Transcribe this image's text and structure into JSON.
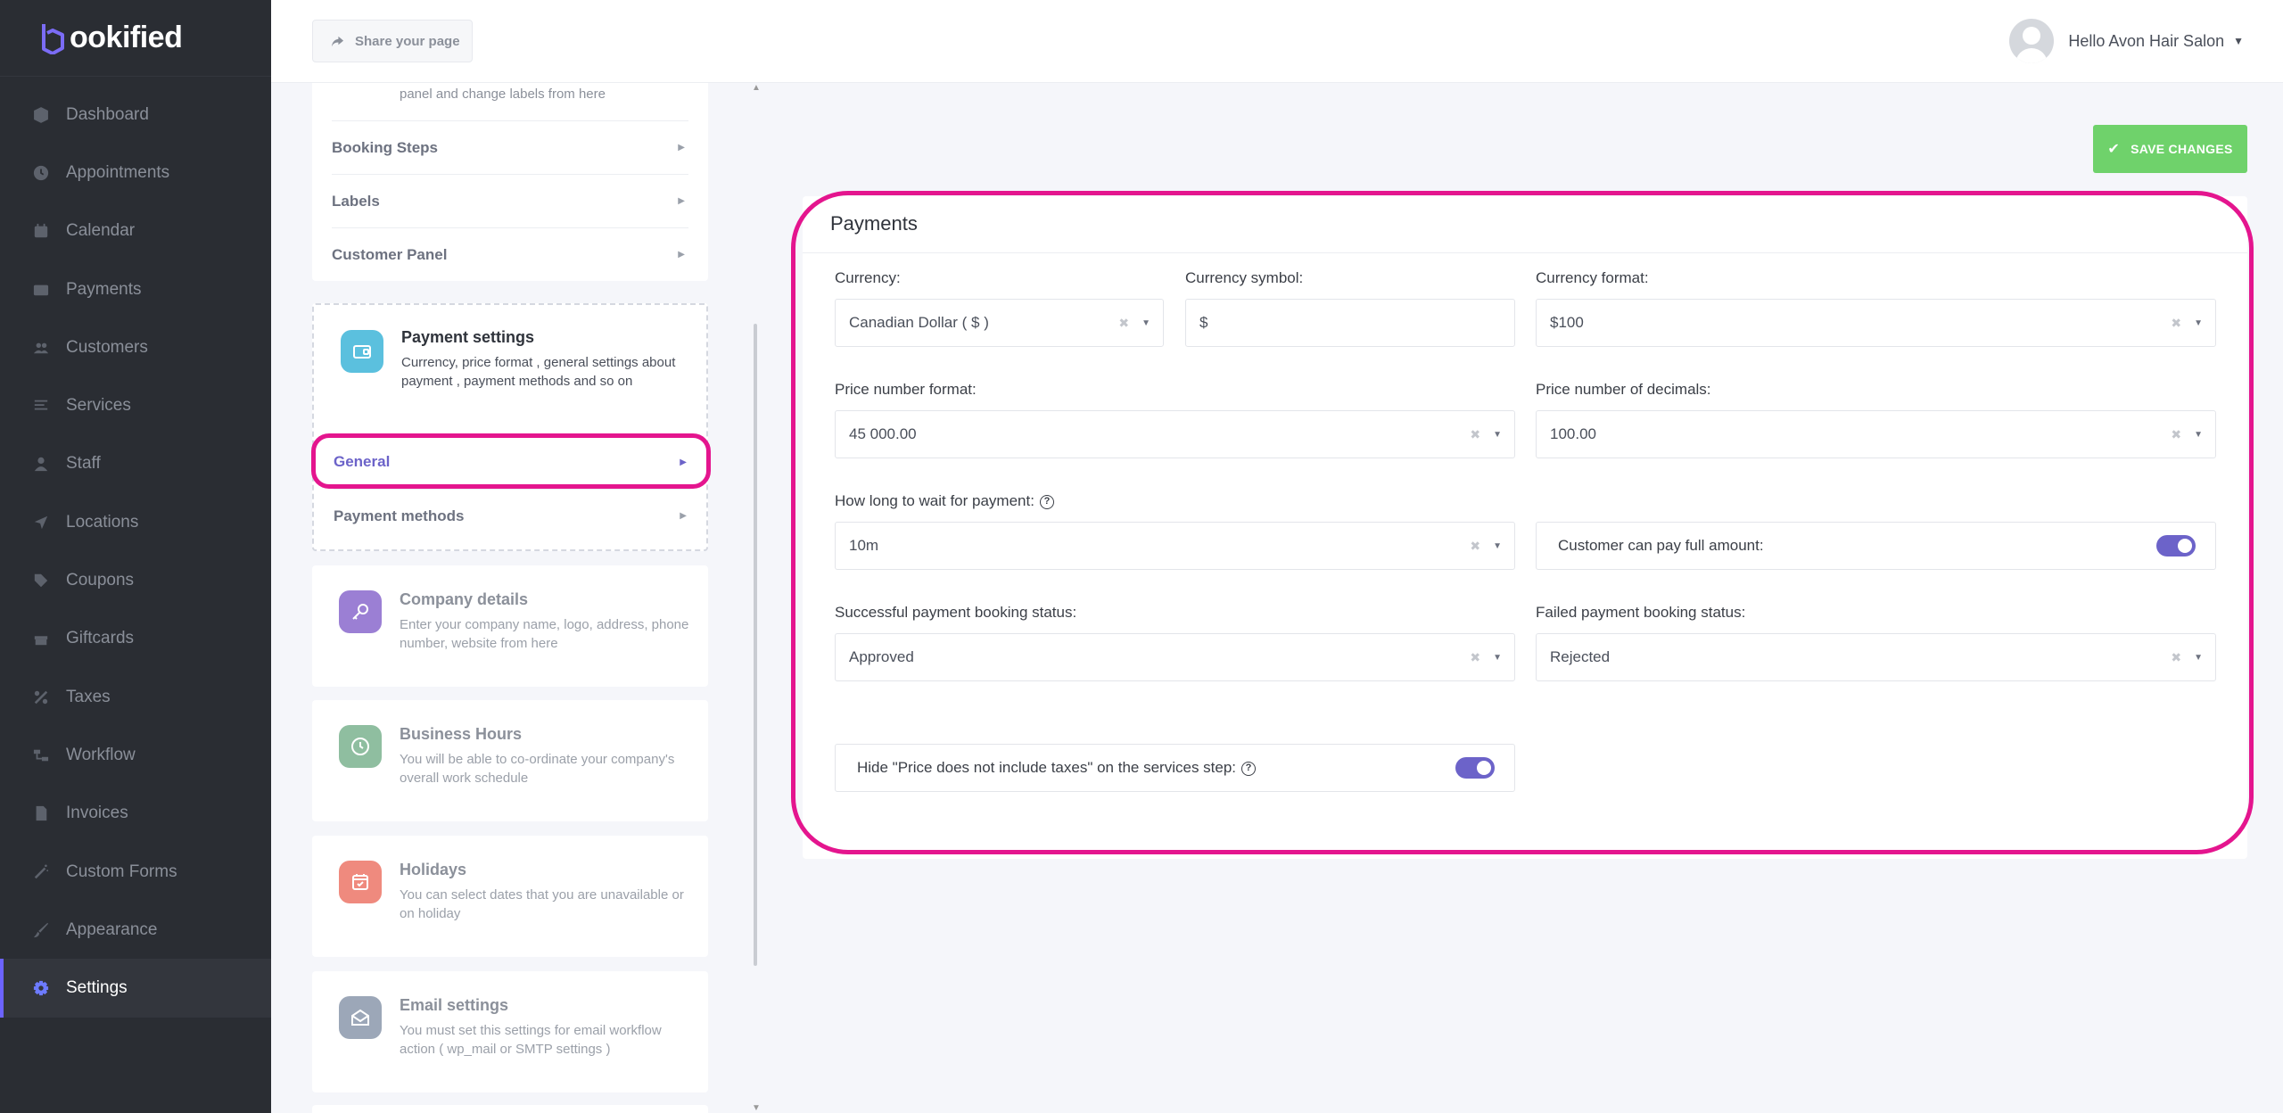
{
  "brand": {
    "logo_text": "ookified"
  },
  "sidebar": {
    "items": [
      {
        "label": "Dashboard",
        "icon": "cube-icon"
      },
      {
        "label": "Appointments",
        "icon": "clock-icon"
      },
      {
        "label": "Calendar",
        "icon": "calendar-icon"
      },
      {
        "label": "Payments",
        "icon": "wallet-icon"
      },
      {
        "label": "Customers",
        "icon": "users-icon"
      },
      {
        "label": "Services",
        "icon": "list-icon"
      },
      {
        "label": "Staff",
        "icon": "user-icon"
      },
      {
        "label": "Locations",
        "icon": "location-arrow-icon"
      },
      {
        "label": "Coupons",
        "icon": "tag-icon"
      },
      {
        "label": "Giftcards",
        "icon": "gift-icon"
      },
      {
        "label": "Taxes",
        "icon": "percent-icon"
      },
      {
        "label": "Workflow",
        "icon": "workflow-icon"
      },
      {
        "label": "Invoices",
        "icon": "invoice-icon"
      },
      {
        "label": "Custom Forms",
        "icon": "wand-icon"
      },
      {
        "label": "Appearance",
        "icon": "brush-icon"
      },
      {
        "label": "Settings",
        "icon": "gear-icon",
        "active": true
      }
    ]
  },
  "topbar": {
    "share_label": "Share your page",
    "user_greeting": "Hello Avon Hair Salon"
  },
  "settings_list": {
    "top_card_desc": "panel and change labels from here",
    "top_card_items": [
      "Booking Steps",
      "Labels",
      "Customer Panel"
    ],
    "payment_card": {
      "title": "Payment settings",
      "desc": "Currency, price format , general settings about payment , payment methods and so on",
      "items": [
        "General",
        "Payment methods"
      ],
      "icon_color": "#5bc0de"
    },
    "cards": [
      {
        "title": "Company details",
        "desc": "Enter your company name, logo, address, phone number, website from here",
        "icon": "key-icon",
        "color": "#9b7fd4"
      },
      {
        "title": "Business Hours",
        "desc": "You will be able to co-ordinate your company's overall work schedule",
        "icon": "clock-icon",
        "color": "#8fbea0"
      },
      {
        "title": "Holidays",
        "desc": "You can select dates that you are unavailable or on holiday",
        "icon": "calendar-check-icon",
        "color": "#ef8a7e"
      },
      {
        "title": "Email settings",
        "desc": "You must set this settings for email workflow action ( wp_mail or SMTP settings )",
        "icon": "envelope-open-icon",
        "color": "#9ca7b8"
      }
    ]
  },
  "main": {
    "save_label": "SAVE CHANGES",
    "panel_title": "Payments",
    "currency": {
      "label": "Currency:",
      "value": "Canadian Dollar ( $ )"
    },
    "currency_symbol": {
      "label": "Currency symbol:",
      "value": "$"
    },
    "currency_format": {
      "label": "Currency format:",
      "value": "$100"
    },
    "price_number_format": {
      "label": "Price number format:",
      "value": "45 000.00"
    },
    "price_decimals": {
      "label": "Price number of decimals:",
      "value": "100.00"
    },
    "wait_for_payment": {
      "label": "How long to wait for payment:",
      "value": "10m"
    },
    "customer_full_amount": {
      "label": "Customer can pay full amount:",
      "on": true
    },
    "successful_status": {
      "label": "Successful payment booking status:",
      "value": "Approved"
    },
    "failed_status": {
      "label": "Failed payment booking status:",
      "value": "Rejected"
    },
    "hide_taxes": {
      "label": "Hide \"Price does not include taxes\" on the services step:",
      "on": true
    }
  },
  "colors": {
    "accent": "#6c63c9",
    "save": "#6fd26b",
    "highlight": "#e4158e",
    "sidebar_bg": "#2a2d33"
  }
}
